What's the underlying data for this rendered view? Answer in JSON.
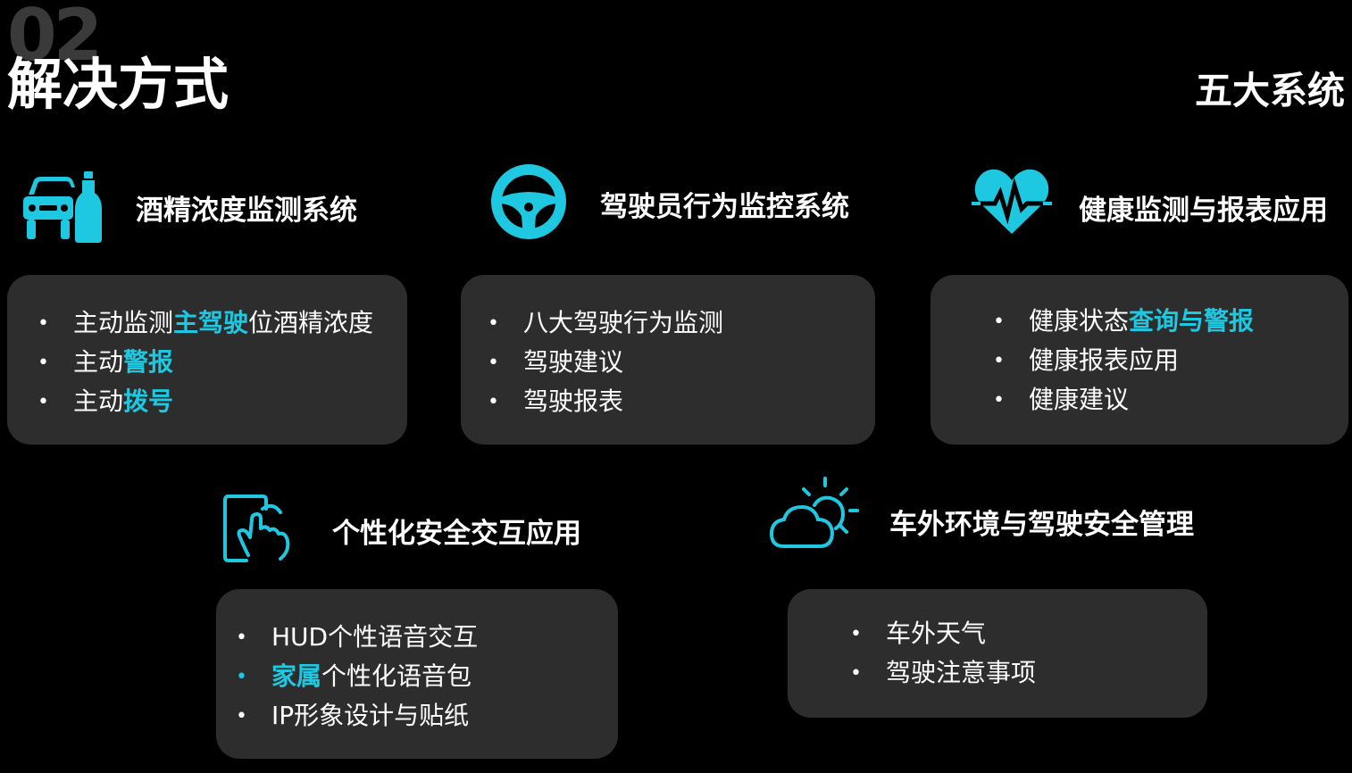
{
  "header": {
    "section_number": "02",
    "title": "解决方式",
    "badge": "五大系统"
  },
  "colors": {
    "accent": "#1ec8e0",
    "card_bg": "#2d2d2d",
    "bg": "#000000"
  },
  "systems": [
    {
      "icon": "car-bottle-icon",
      "heading": "酒精浓度监测系统",
      "items": [
        {
          "pre": "主动监测",
          "hl": "主驾驶",
          "post": "位酒精浓度"
        },
        {
          "pre": "主动",
          "hl": "警报",
          "post": ""
        },
        {
          "pre": "主动",
          "hl": "拨号",
          "post": ""
        }
      ]
    },
    {
      "icon": "steering-wheel-icon",
      "heading": "驾驶员行为监控系统",
      "items": [
        {
          "pre": "八大驾驶行为监测",
          "hl": "",
          "post": ""
        },
        {
          "pre": "驾驶建议",
          "hl": "",
          "post": ""
        },
        {
          "pre": "驾驶报表",
          "hl": "",
          "post": ""
        }
      ]
    },
    {
      "icon": "heartbeat-icon",
      "heading": "健康监测与报表应用",
      "items": [
        {
          "pre": "健康状态",
          "hl": "查询与警报",
          "post": ""
        },
        {
          "pre": "健康报表应用",
          "hl": "",
          "post": ""
        },
        {
          "pre": "健康建议",
          "hl": "",
          "post": ""
        }
      ]
    },
    {
      "icon": "touch-hand-icon",
      "heading": "个性化安全交互应用",
      "items": [
        {
          "pre": "HUD个性语音交互",
          "hl": "",
          "post": ""
        },
        {
          "pre": "",
          "hl": "家属",
          "post": "个性化语音包"
        },
        {
          "pre": "IP形象设计与贴纸",
          "hl": "",
          "post": ""
        }
      ]
    },
    {
      "icon": "weather-sun-cloud-icon",
      "heading": "车外环境与驾驶安全管理",
      "items": [
        {
          "pre": "车外天气",
          "hl": "",
          "post": ""
        },
        {
          "pre": "驾驶注意事项",
          "hl": "",
          "post": ""
        }
      ]
    }
  ]
}
